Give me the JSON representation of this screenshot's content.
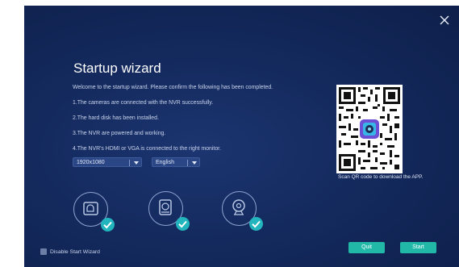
{
  "dialog": {
    "title": "Startup wizard",
    "intro": "Welcome to the startup wizard. Please confirm the following has been completed.",
    "checklist": [
      "1.The cameras are connected with the NVR successfully.",
      "2.The hard disk has been installed.",
      "3.The NVR are powered and working.",
      "4.The NVR's HDMI or VGA is connected to the right monitor."
    ],
    "resolution": {
      "selected": "1920x1080"
    },
    "language": {
      "selected": "English"
    },
    "qr_caption": "Scan QR code to download the APP.",
    "status_items": [
      {
        "icon": "nvr-device-icon",
        "status": "completed"
      },
      {
        "icon": "hard-disk-icon",
        "status": "completed"
      },
      {
        "icon": "camera-icon",
        "status": "completed"
      }
    ],
    "disable_label": "Disable Start Wizard",
    "quit_label": "Quit",
    "start_label": "Start",
    "close_icon": "close-icon"
  },
  "colors": {
    "background": "#142a5e",
    "accent": "#21b8a8",
    "check": "#23b5be",
    "text": "#dfe6f5"
  }
}
